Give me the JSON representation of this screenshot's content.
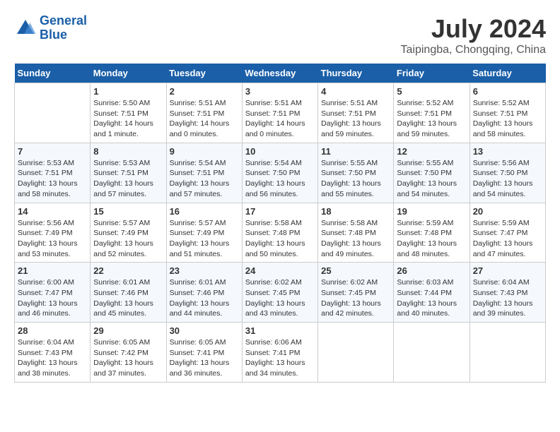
{
  "header": {
    "logo_line1": "General",
    "logo_line2": "Blue",
    "month": "July 2024",
    "location": "Taipingba, Chongqing, China"
  },
  "weekdays": [
    "Sunday",
    "Monday",
    "Tuesday",
    "Wednesday",
    "Thursday",
    "Friday",
    "Saturday"
  ],
  "weeks": [
    [
      {
        "day": "",
        "info": ""
      },
      {
        "day": "1",
        "info": "Sunrise: 5:50 AM\nSunset: 7:51 PM\nDaylight: 14 hours\nand 1 minute."
      },
      {
        "day": "2",
        "info": "Sunrise: 5:51 AM\nSunset: 7:51 PM\nDaylight: 14 hours\nand 0 minutes."
      },
      {
        "day": "3",
        "info": "Sunrise: 5:51 AM\nSunset: 7:51 PM\nDaylight: 14 hours\nand 0 minutes."
      },
      {
        "day": "4",
        "info": "Sunrise: 5:51 AM\nSunset: 7:51 PM\nDaylight: 13 hours\nand 59 minutes."
      },
      {
        "day": "5",
        "info": "Sunrise: 5:52 AM\nSunset: 7:51 PM\nDaylight: 13 hours\nand 59 minutes."
      },
      {
        "day": "6",
        "info": "Sunrise: 5:52 AM\nSunset: 7:51 PM\nDaylight: 13 hours\nand 58 minutes."
      }
    ],
    [
      {
        "day": "7",
        "info": "Sunrise: 5:53 AM\nSunset: 7:51 PM\nDaylight: 13 hours\nand 58 minutes."
      },
      {
        "day": "8",
        "info": "Sunrise: 5:53 AM\nSunset: 7:51 PM\nDaylight: 13 hours\nand 57 minutes."
      },
      {
        "day": "9",
        "info": "Sunrise: 5:54 AM\nSunset: 7:51 PM\nDaylight: 13 hours\nand 57 minutes."
      },
      {
        "day": "10",
        "info": "Sunrise: 5:54 AM\nSunset: 7:50 PM\nDaylight: 13 hours\nand 56 minutes."
      },
      {
        "day": "11",
        "info": "Sunrise: 5:55 AM\nSunset: 7:50 PM\nDaylight: 13 hours\nand 55 minutes."
      },
      {
        "day": "12",
        "info": "Sunrise: 5:55 AM\nSunset: 7:50 PM\nDaylight: 13 hours\nand 54 minutes."
      },
      {
        "day": "13",
        "info": "Sunrise: 5:56 AM\nSunset: 7:50 PM\nDaylight: 13 hours\nand 54 minutes."
      }
    ],
    [
      {
        "day": "14",
        "info": "Sunrise: 5:56 AM\nSunset: 7:49 PM\nDaylight: 13 hours\nand 53 minutes."
      },
      {
        "day": "15",
        "info": "Sunrise: 5:57 AM\nSunset: 7:49 PM\nDaylight: 13 hours\nand 52 minutes."
      },
      {
        "day": "16",
        "info": "Sunrise: 5:57 AM\nSunset: 7:49 PM\nDaylight: 13 hours\nand 51 minutes."
      },
      {
        "day": "17",
        "info": "Sunrise: 5:58 AM\nSunset: 7:48 PM\nDaylight: 13 hours\nand 50 minutes."
      },
      {
        "day": "18",
        "info": "Sunrise: 5:58 AM\nSunset: 7:48 PM\nDaylight: 13 hours\nand 49 minutes."
      },
      {
        "day": "19",
        "info": "Sunrise: 5:59 AM\nSunset: 7:48 PM\nDaylight: 13 hours\nand 48 minutes."
      },
      {
        "day": "20",
        "info": "Sunrise: 5:59 AM\nSunset: 7:47 PM\nDaylight: 13 hours\nand 47 minutes."
      }
    ],
    [
      {
        "day": "21",
        "info": "Sunrise: 6:00 AM\nSunset: 7:47 PM\nDaylight: 13 hours\nand 46 minutes."
      },
      {
        "day": "22",
        "info": "Sunrise: 6:01 AM\nSunset: 7:46 PM\nDaylight: 13 hours\nand 45 minutes."
      },
      {
        "day": "23",
        "info": "Sunrise: 6:01 AM\nSunset: 7:46 PM\nDaylight: 13 hours\nand 44 minutes."
      },
      {
        "day": "24",
        "info": "Sunrise: 6:02 AM\nSunset: 7:45 PM\nDaylight: 13 hours\nand 43 minutes."
      },
      {
        "day": "25",
        "info": "Sunrise: 6:02 AM\nSunset: 7:45 PM\nDaylight: 13 hours\nand 42 minutes."
      },
      {
        "day": "26",
        "info": "Sunrise: 6:03 AM\nSunset: 7:44 PM\nDaylight: 13 hours\nand 40 minutes."
      },
      {
        "day": "27",
        "info": "Sunrise: 6:04 AM\nSunset: 7:43 PM\nDaylight: 13 hours\nand 39 minutes."
      }
    ],
    [
      {
        "day": "28",
        "info": "Sunrise: 6:04 AM\nSunset: 7:43 PM\nDaylight: 13 hours\nand 38 minutes."
      },
      {
        "day": "29",
        "info": "Sunrise: 6:05 AM\nSunset: 7:42 PM\nDaylight: 13 hours\nand 37 minutes."
      },
      {
        "day": "30",
        "info": "Sunrise: 6:05 AM\nSunset: 7:41 PM\nDaylight: 13 hours\nand 36 minutes."
      },
      {
        "day": "31",
        "info": "Sunrise: 6:06 AM\nSunset: 7:41 PM\nDaylight: 13 hours\nand 34 minutes."
      },
      {
        "day": "",
        "info": ""
      },
      {
        "day": "",
        "info": ""
      },
      {
        "day": "",
        "info": ""
      }
    ]
  ]
}
